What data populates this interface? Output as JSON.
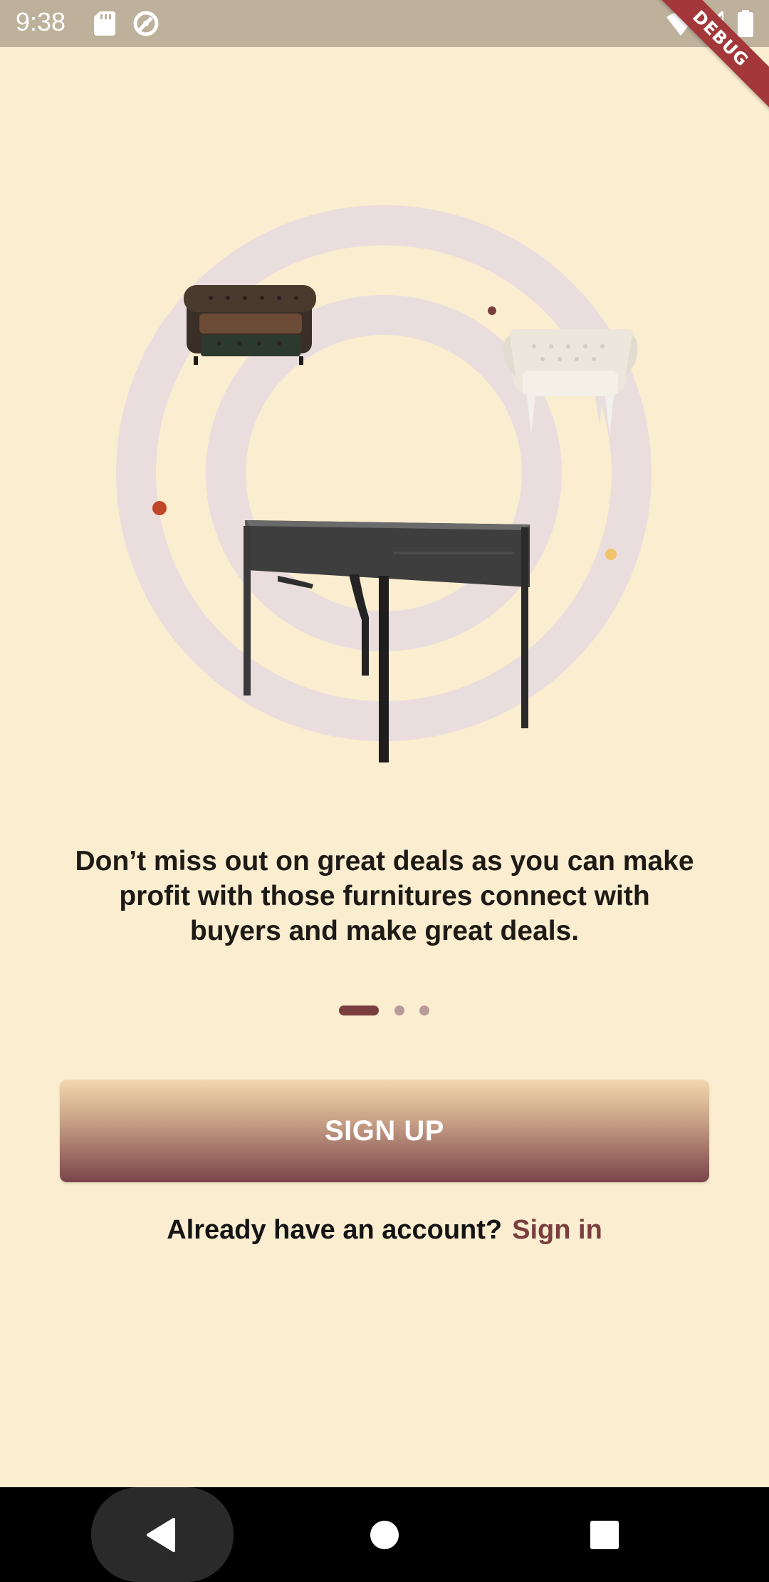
{
  "status_bar": {
    "time": "9:38",
    "icons": [
      "sd-card-icon",
      "sync-icon",
      "wifi-icon",
      "signal-icon",
      "battery-icon"
    ],
    "debug_label": "DEBUG"
  },
  "onboarding": {
    "description": "Don’t miss out on great deals as you can make profit with those furnitures connect with buyers and make great deals.",
    "page_indicator": {
      "total": 3,
      "active_index": 0
    },
    "signup_label": "SIGN UP",
    "signin_prompt": "Already have an account?",
    "signin_link": "Sign in"
  },
  "colors": {
    "background": "#FAEDD0",
    "status_bar": "#BEB19B",
    "accent": "#7A3E3F",
    "ring": "#EADDDD",
    "debug_ribbon": "#A3373A"
  },
  "navigation_bar": {
    "buttons": [
      "back-icon",
      "home-icon",
      "recents-icon"
    ]
  }
}
